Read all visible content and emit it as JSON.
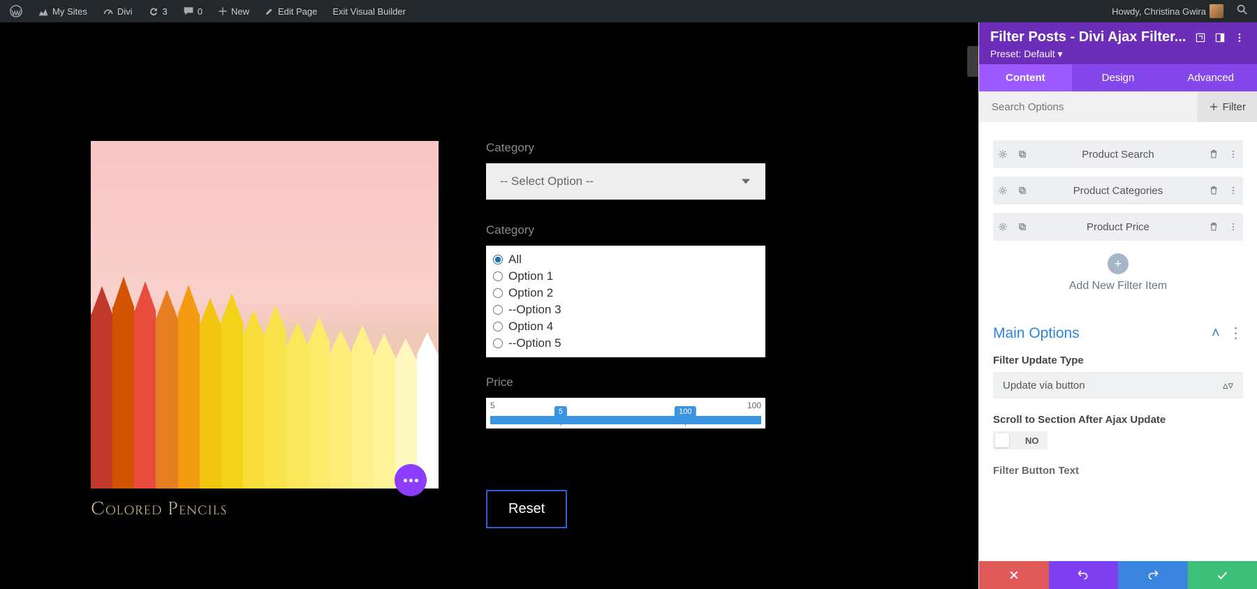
{
  "wpbar": {
    "my_sites": "My Sites",
    "divi": "Divi",
    "updates_count": "3",
    "comments_count": "0",
    "new": "New",
    "edit_page": "Edit Page",
    "exit_vb": "Exit Visual Builder",
    "howdy": "Howdy, Christina Gwira"
  },
  "preview": {
    "product_title": "Colored Pencils",
    "category_label_1": "Category",
    "select_placeholder": "-- Select Option --",
    "category_label_2": "Category",
    "radios": {
      "all": "All",
      "opt1": "Option 1",
      "opt2": "Option 2",
      "opt3": "--Option 3",
      "opt4": "Option 4",
      "opt5": "--Option 5"
    },
    "price_label": "Price",
    "price_min": "5",
    "price_max": "100",
    "slider_low": "5",
    "slider_high": "100",
    "reset": "Reset"
  },
  "panel": {
    "title": "Filter Posts - Divi Ajax Filter...",
    "preset": "Preset: Default",
    "tabs": {
      "content": "Content",
      "design": "Design",
      "advanced": "Advanced"
    },
    "search_placeholder": "Search Options",
    "add_filter": "Filter",
    "items": {
      "i0": "Product Search",
      "i1": "Product Categories",
      "i2": "Product Price"
    },
    "add_item": "Add New Filter Item",
    "main_options": "Main Options",
    "filter_update_type_label": "Filter Update Type",
    "filter_update_type_value": "Update via button",
    "scroll_label": "Scroll to Section After Ajax Update",
    "scroll_value": "NO",
    "filter_button_text_label": "Filter Button Text"
  }
}
